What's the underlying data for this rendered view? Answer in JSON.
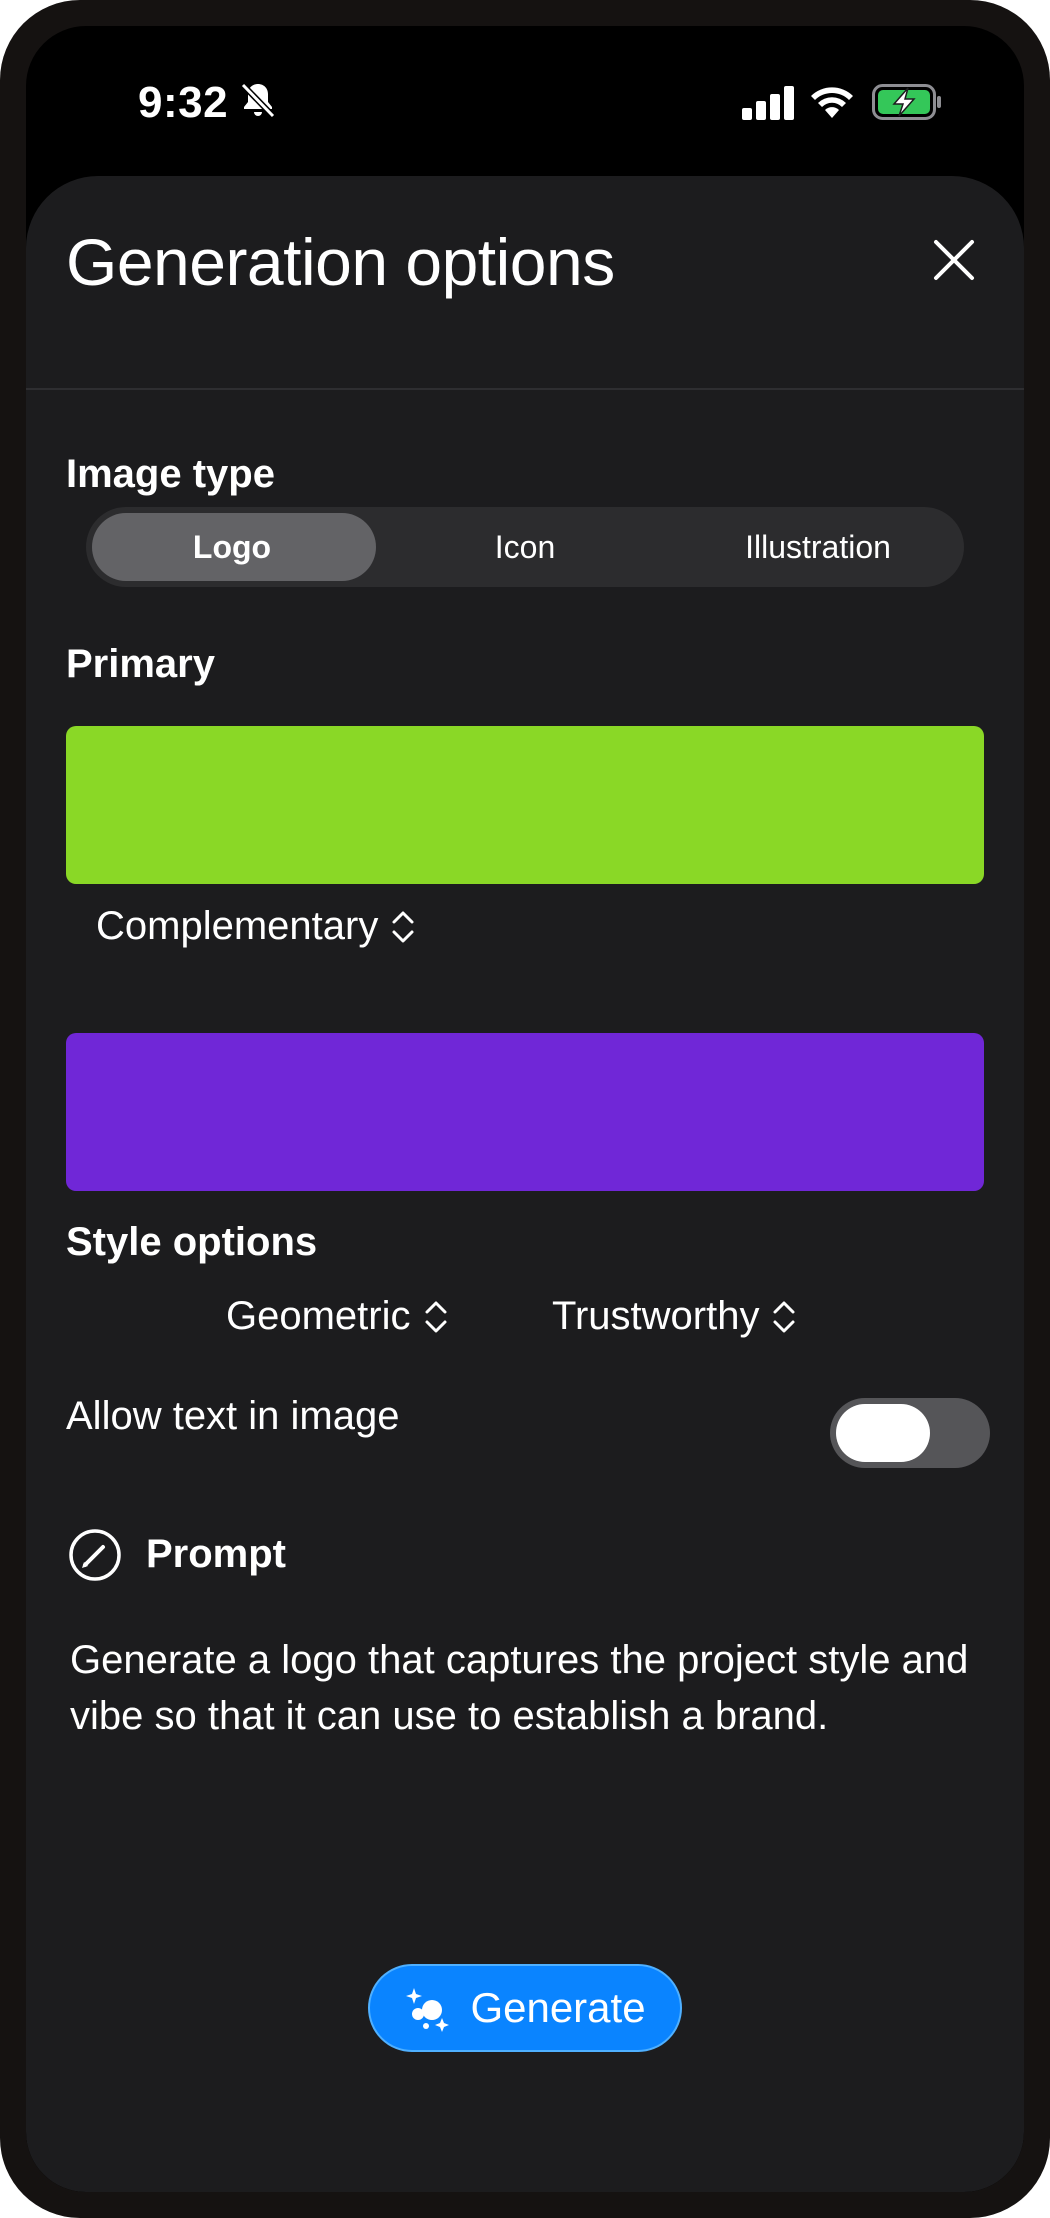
{
  "status_bar": {
    "time": "9:32",
    "icons": [
      "bell-slash-icon",
      "cellular-signal-icon",
      "wifi-icon",
      "battery-charging-icon"
    ],
    "battery_color": "#34c759"
  },
  "sheet": {
    "title": "Generation options",
    "close_icon": "close-icon"
  },
  "image_type": {
    "label": "Image type",
    "options": [
      "Logo",
      "Icon",
      "Illustration"
    ],
    "selected": "Logo"
  },
  "primary": {
    "label": "Primary",
    "color": "#8ad826"
  },
  "scheme": {
    "value": "Complementary",
    "secondary_color": "#7027d7"
  },
  "style_options": {
    "label": "Style options",
    "shape": "Geometric",
    "mood": "Trustworthy"
  },
  "allow_text": {
    "label": "Allow text in image",
    "enabled": false
  },
  "prompt": {
    "label": "Prompt",
    "icon": "pencil-circle-icon",
    "text": "Generate a logo that captures the project style and vibe so that it can use to establish a brand."
  },
  "generate": {
    "label": "Generate",
    "icon": "sparkles-icon",
    "color": "#0a84ff"
  }
}
